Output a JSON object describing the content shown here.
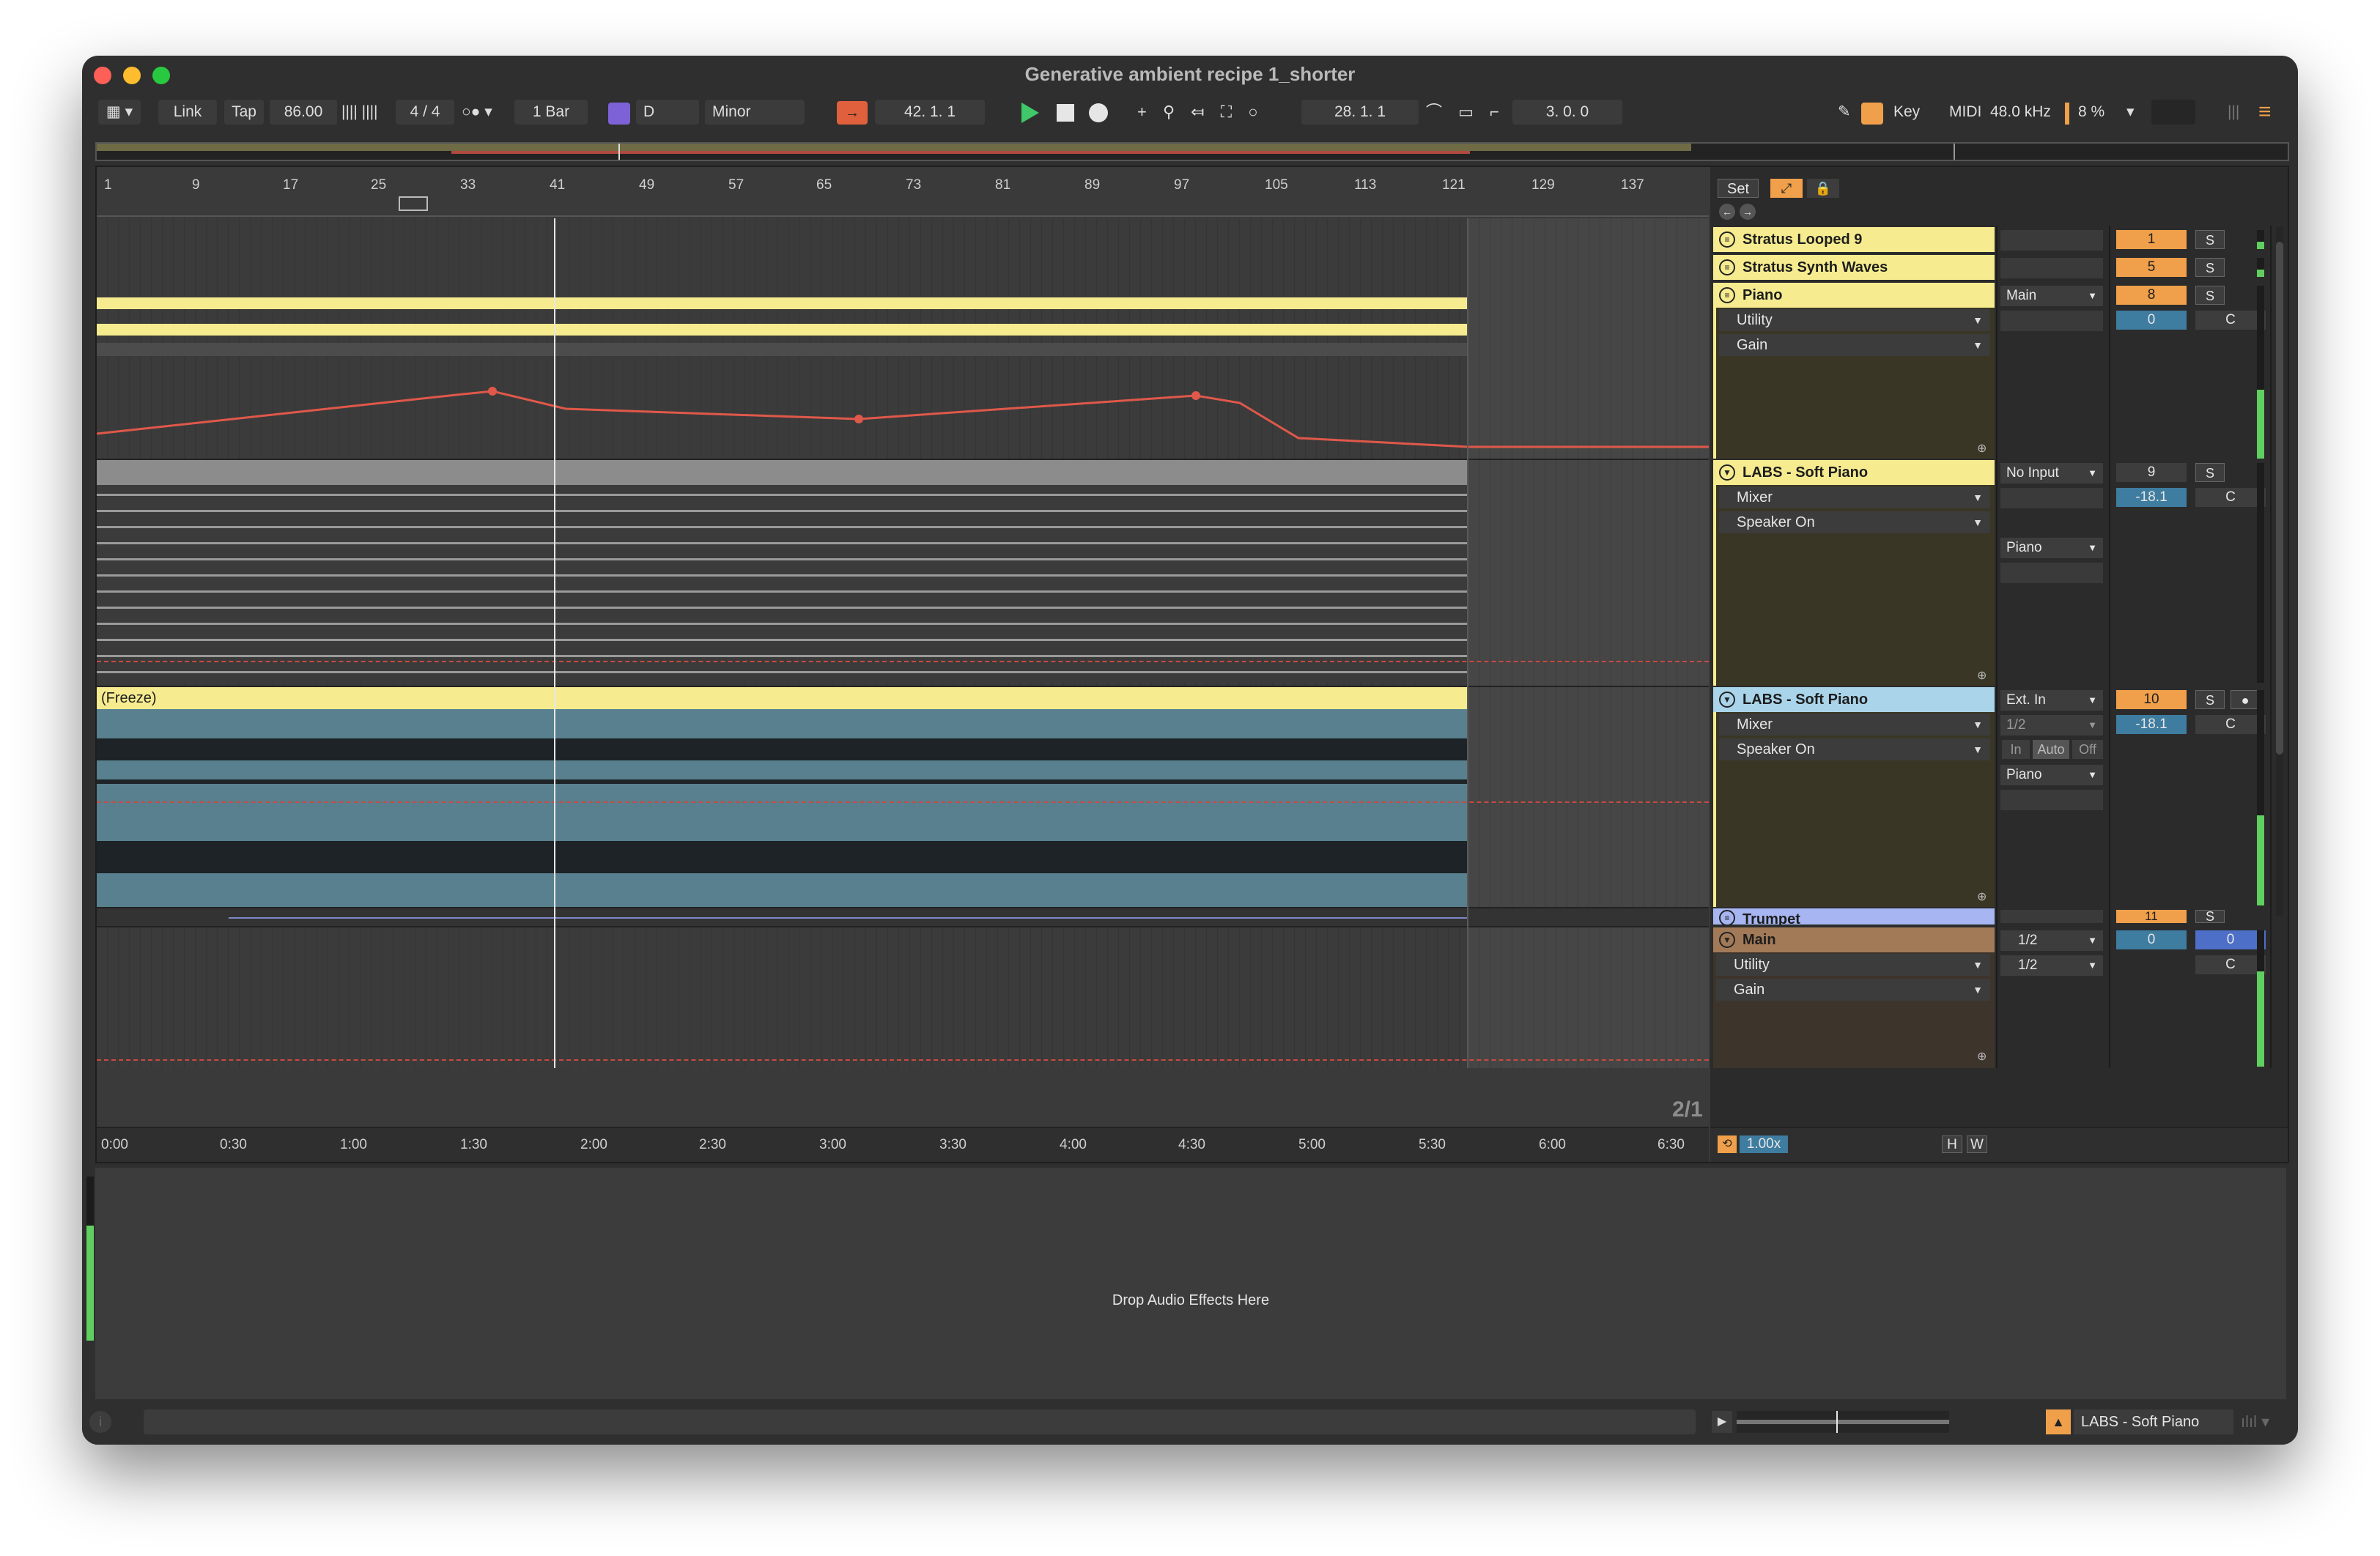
{
  "window": {
    "title": "Generative ambient recipe 1_shorter"
  },
  "toolbar": {
    "link": "Link",
    "tap": "Tap",
    "tempo": "86.00",
    "signature": "4 / 4",
    "quantize": "1 Bar",
    "key_root": "D",
    "scale": "Minor",
    "position": "42.  1.  1",
    "loop_start": "28.  1.  1",
    "loop_length": "3.  0.  0",
    "key": "Key",
    "midi": "MIDI",
    "sample_rate": "48.0 kHz",
    "cpu": "8 %"
  },
  "ruler": {
    "bars": [
      "1",
      "9",
      "17",
      "25",
      "33",
      "41",
      "49",
      "57",
      "65",
      "73",
      "81",
      "89",
      "97",
      "105",
      "113",
      "121",
      "129",
      "137"
    ],
    "times": [
      "0:00",
      "0:30",
      "1:00",
      "1:30",
      "2:00",
      "2:30",
      "3:00",
      "3:30",
      "4:00",
      "4:30",
      "5:00",
      "5:30",
      "6:00",
      "6:30"
    ],
    "zoom_label": "2/1"
  },
  "set_panel": {
    "set_label": "Set"
  },
  "clips": {
    "freeze_label": "(Freeze)"
  },
  "tracks": [
    {
      "name": "Stratus Looped 9",
      "number": "1",
      "solo": "S"
    },
    {
      "name": "Stratus Synth Waves",
      "number": "5",
      "solo": "S"
    },
    {
      "name": "Piano",
      "number": "8",
      "solo": "S",
      "output": "Main",
      "volume": "0",
      "pan": "C",
      "devices": [
        "Utility",
        "Gain"
      ]
    },
    {
      "name": "LABS - Soft Piano",
      "number": "9",
      "solo": "S",
      "input": "No Input",
      "volume": "-18.1",
      "pan": "C",
      "devices": [
        "Mixer",
        "Speaker On"
      ],
      "output": "Piano"
    },
    {
      "name": "LABS - Soft Piano",
      "number": "10",
      "solo": "S",
      "input": "Ext. In",
      "channel": "1/2",
      "volume": "-18.1",
      "pan": "C",
      "devices": [
        "Mixer",
        "Speaker On"
      ],
      "monitor": [
        "In",
        "Auto",
        "Off"
      ],
      "output": "Piano"
    },
    {
      "name": "Trumpet",
      "number": "11",
      "solo": "S"
    },
    {
      "name": "Main",
      "volume": "0",
      "volume_b": "0",
      "pan": "C",
      "ch_a": "1/2",
      "ch_b": "1/2",
      "devices": [
        "Utility",
        "Gain"
      ]
    }
  ],
  "footer_controls": {
    "tempo_factor": "1.00x",
    "h": "H",
    "w": "W"
  },
  "bottom": {
    "drop_hint": "Drop Audio Effects Here",
    "selected_device": "LABS - Soft Piano"
  },
  "colors": {
    "accent_orange": "#f0a04b",
    "clip_yellow": "#f6ec8f",
    "clip_blue": "#a9d4ea",
    "main_brown": "#a27a58",
    "automation_red": "#e0584a"
  }
}
